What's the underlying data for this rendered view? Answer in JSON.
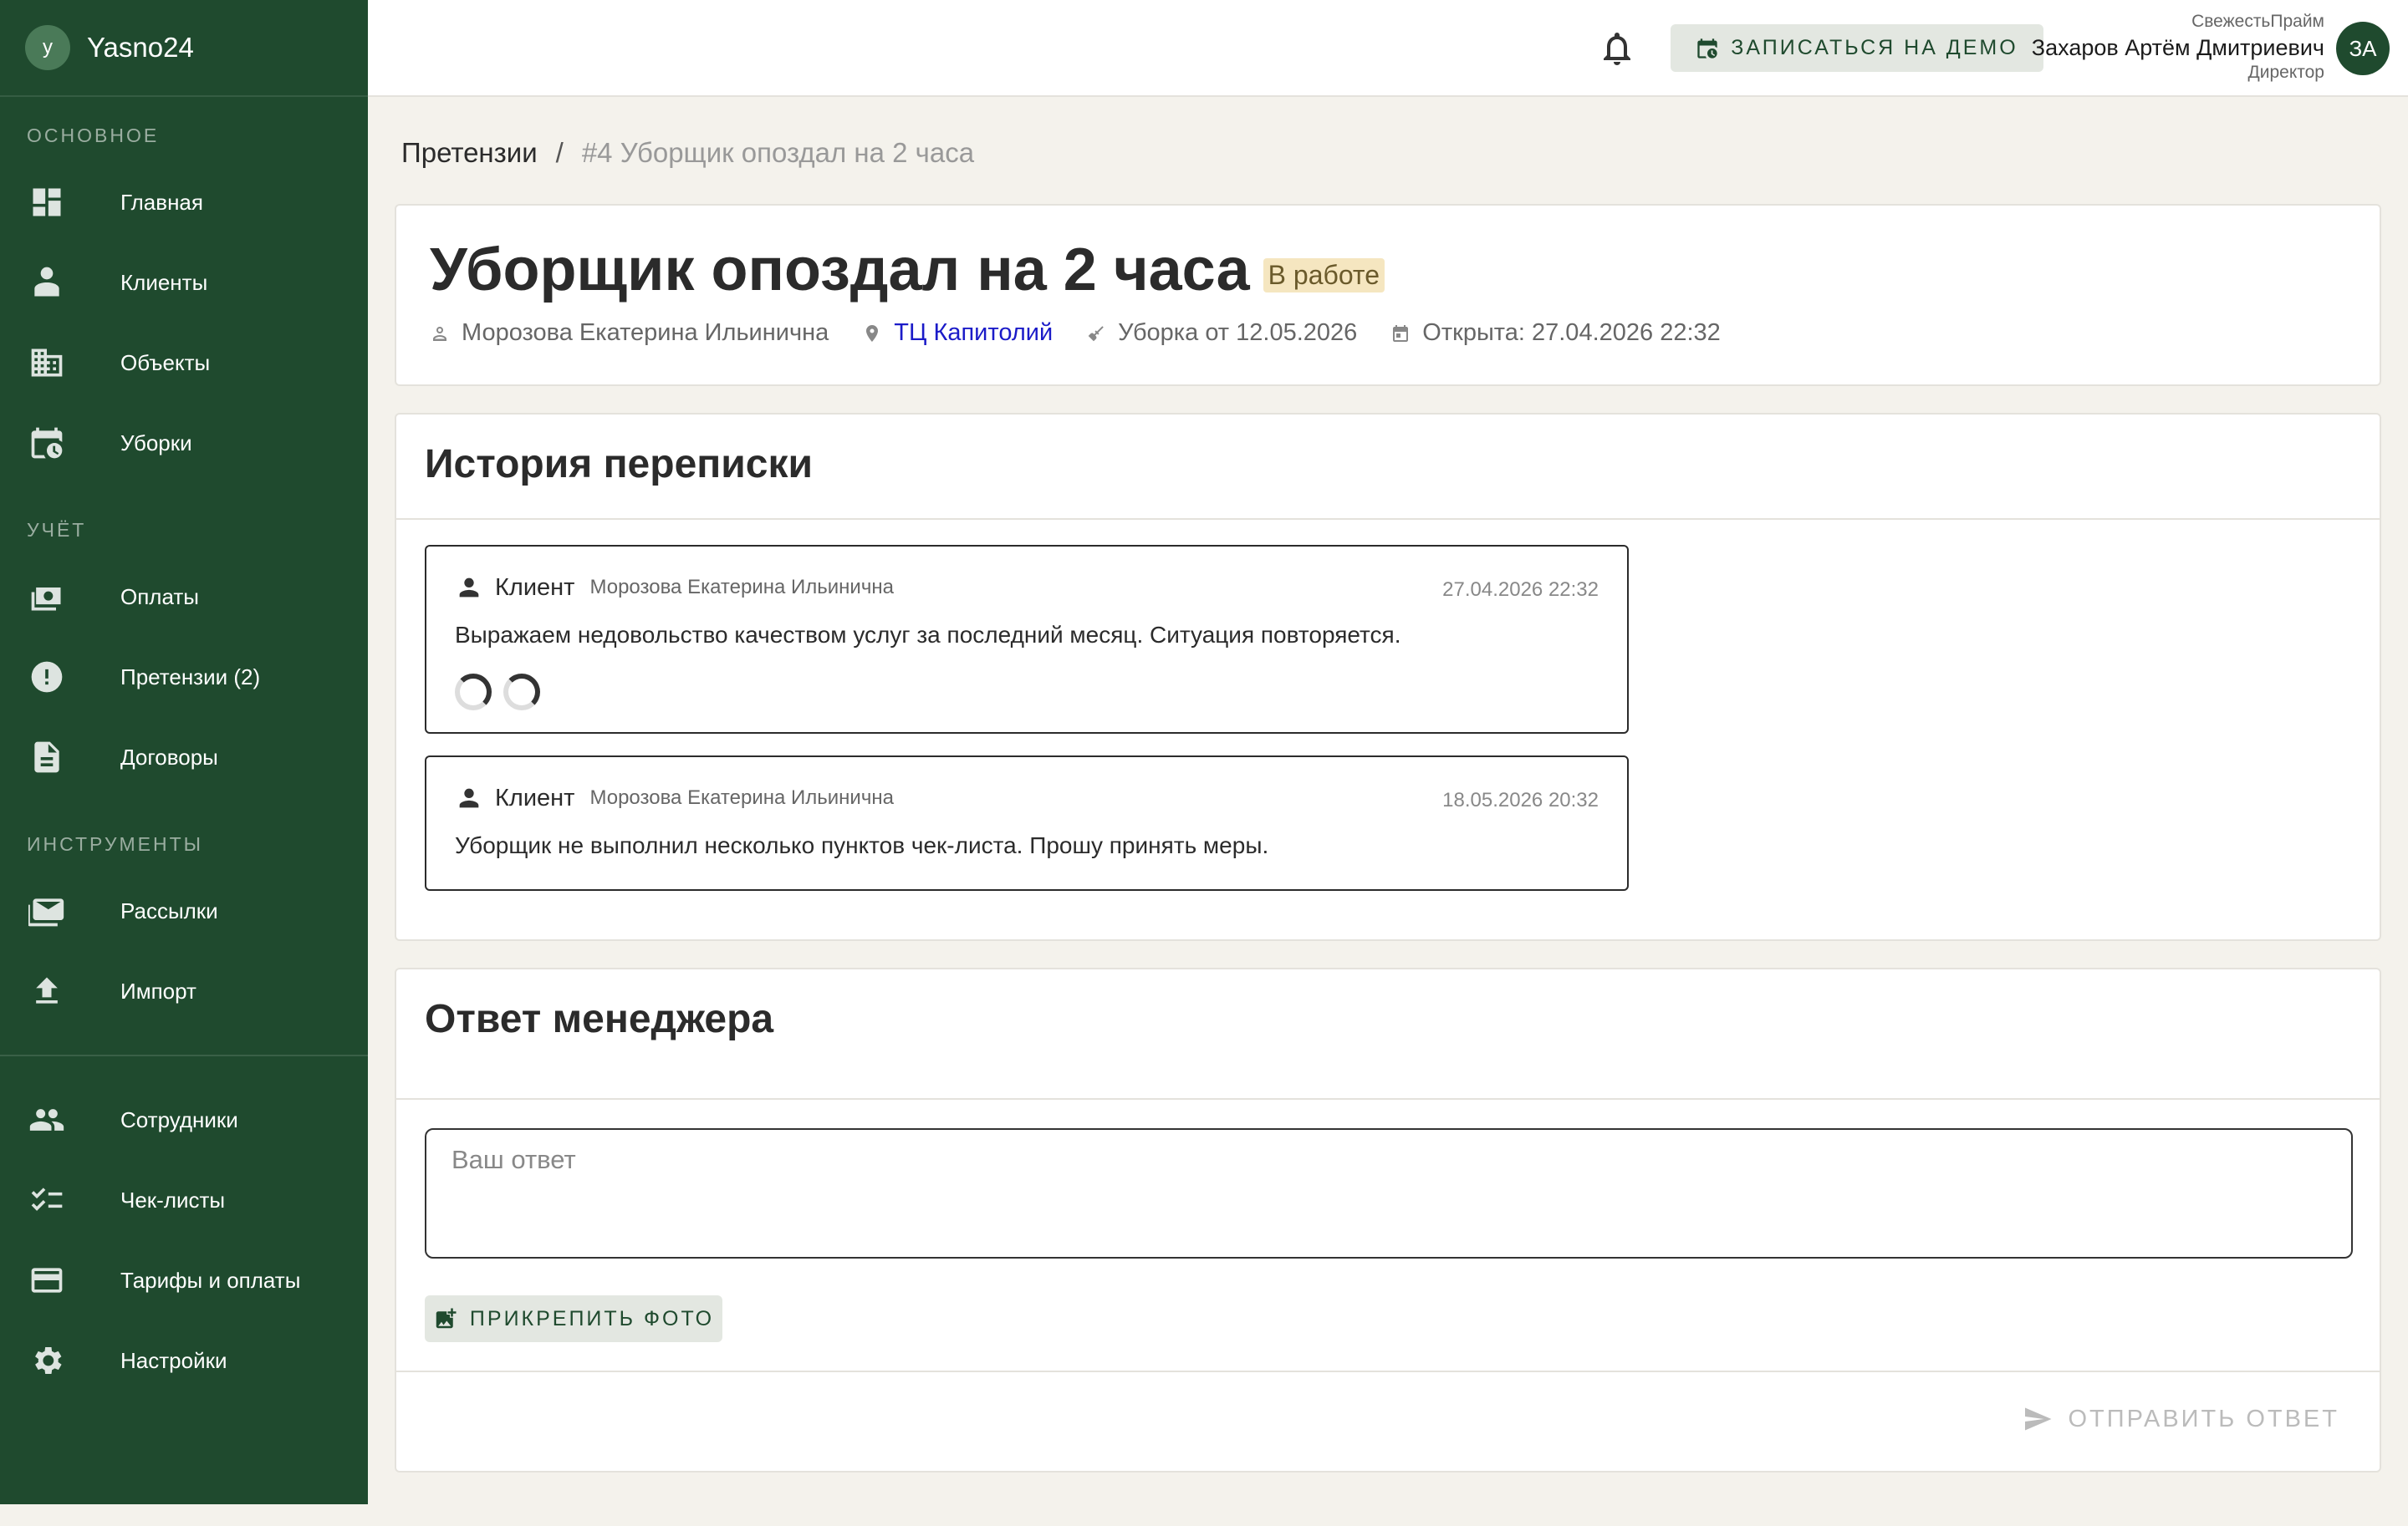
{
  "brand": {
    "logo_letter": "y",
    "name": "Yasno24"
  },
  "sidebar": {
    "sections": [
      {
        "label": "ОСНОВНОЕ"
      },
      {
        "label": "УЧЁТ"
      },
      {
        "label": "ИНСТРУМЕНТЫ"
      }
    ],
    "items": [
      {
        "label": "Главная",
        "icon": "dashboard-icon"
      },
      {
        "label": "Клиенты",
        "icon": "clients-icon"
      },
      {
        "label": "Объекты",
        "icon": "building-icon"
      },
      {
        "label": "Уборки",
        "icon": "calendar-clock-icon"
      },
      {
        "label": "Оплаты",
        "icon": "money-icon"
      },
      {
        "label": "Претензии (2)",
        "icon": "alert-icon"
      },
      {
        "label": "Договоры",
        "icon": "document-icon"
      },
      {
        "label": "Рассылки",
        "icon": "mail-icon"
      },
      {
        "label": "Импорт",
        "icon": "upload-icon"
      },
      {
        "label": "Сотрудники",
        "icon": "people-icon"
      },
      {
        "label": "Чек-листы",
        "icon": "checklist-icon"
      },
      {
        "label": "Тарифы и оплаты",
        "icon": "credit-card-icon"
      },
      {
        "label": "Настройки",
        "icon": "gear-icon"
      }
    ]
  },
  "topbar": {
    "demo_label": "ЗАПИСАТЬСЯ НА ДЕМО",
    "user": {
      "company": "СвежестьПрайм",
      "name": "Захаров Артём Дмитриевич",
      "role": "Директор",
      "initials": "ЗА"
    }
  },
  "breadcrumb": {
    "parent": "Претензии",
    "separator": "/",
    "current": "#4 Уборщик опоздал на 2 часа"
  },
  "claim": {
    "title": "Уборщик опоздал на 2 часа",
    "status": "В работе",
    "client": "Морозова Екатерина Ильинична",
    "object": "ТЦ Капитолий",
    "cleaning": "Уборка от 12.05.2026",
    "opened": "Открыта: 27.04.2026 22:32"
  },
  "history": {
    "title": "История переписки",
    "messages": [
      {
        "role": "Клиент",
        "author": "Морозова Екатерина Ильинична",
        "date": "27.04.2026 22:32",
        "text": "Выражаем недовольство качеством услуг за последний месяц. Ситуация повторяется."
      },
      {
        "role": "Клиент",
        "author": "Морозова Екатерина Ильинична",
        "date": "18.05.2026 20:32",
        "text": "Уборщик не выполнил несколько пунктов чек-листа. Прошу принять меры."
      }
    ]
  },
  "answer": {
    "title": "Ответ менеджера",
    "placeholder": "Ваш ответ",
    "value": "",
    "attach_label": "ПРИКРЕПИТЬ ФОТО",
    "send_label": "ОТПРАВИТЬ ОТВЕТ"
  },
  "colors": {
    "sidebar": "#1f4a2e",
    "accent": "#1f4a2e",
    "badge": "#f5e6c0",
    "link": "#1b1bc8"
  }
}
